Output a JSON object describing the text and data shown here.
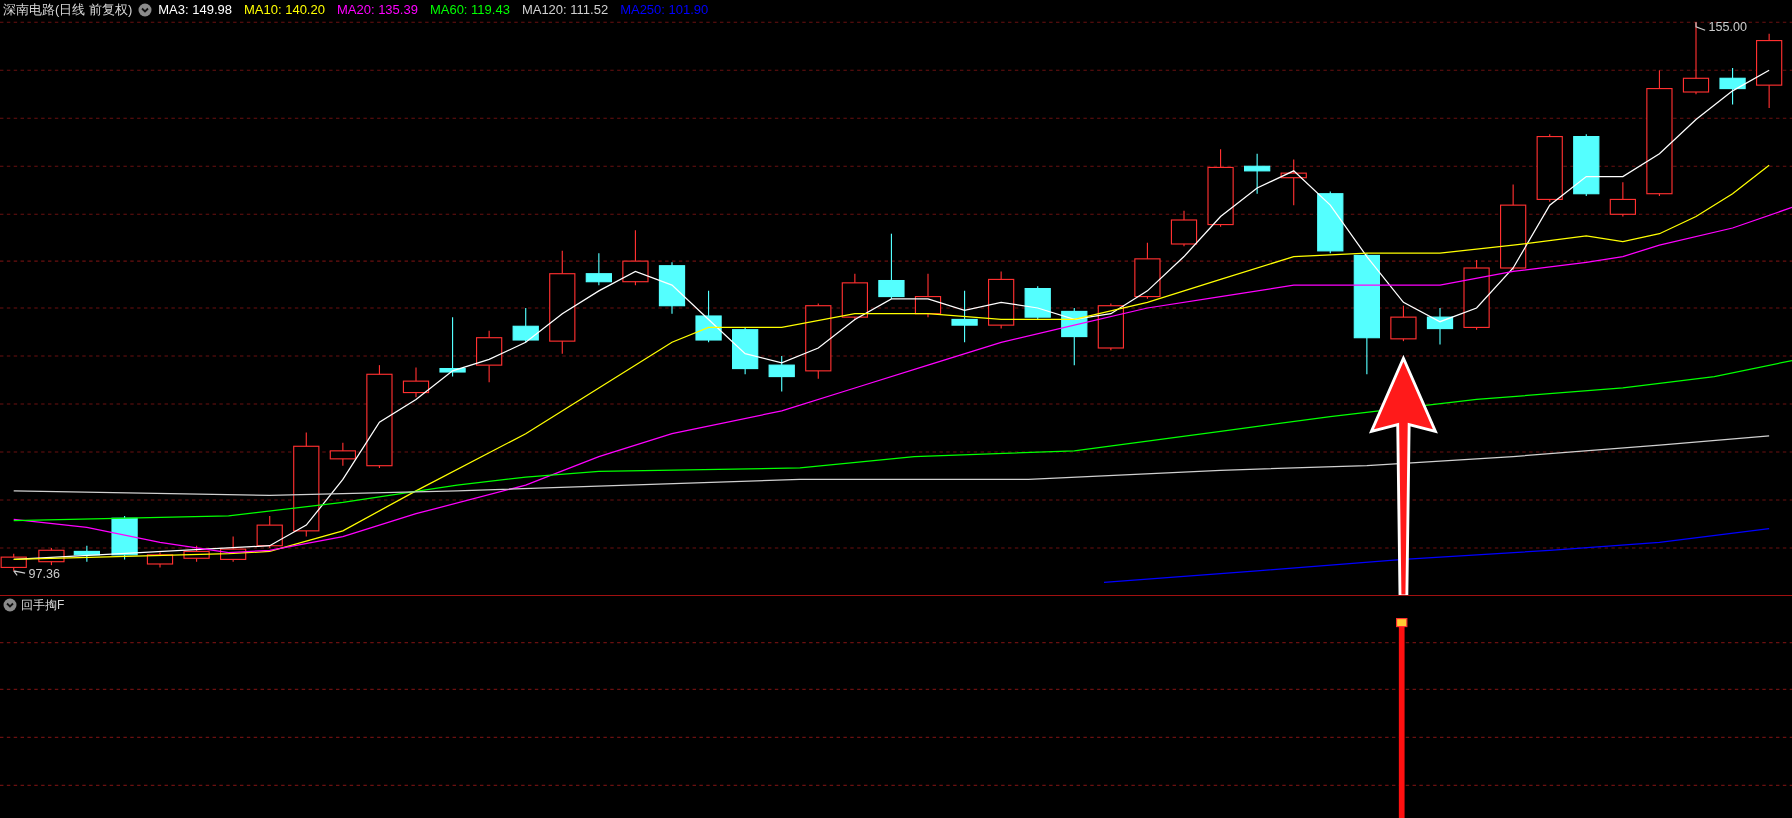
{
  "main_chart": {
    "title": "深南电路(日线 前复权)",
    "moving_averages": [
      {
        "label": "MA3: 149.98",
        "color": "#ffffff"
      },
      {
        "label": "MA10: 140.20",
        "color": "#ffff00"
      },
      {
        "label": "MA20: 135.39",
        "color": "#ff00ff"
      },
      {
        "label": "MA60: 119.43",
        "color": "#00ff00"
      },
      {
        "label": "MA120: 111.52",
        "color": "#d0d0d0"
      },
      {
        "label": "MA250: 101.90",
        "color": "#0000ff"
      }
    ],
    "high_label": "155.00",
    "low_label": "97.36"
  },
  "indicator_pane": {
    "title": "回手掏F"
  }
}
